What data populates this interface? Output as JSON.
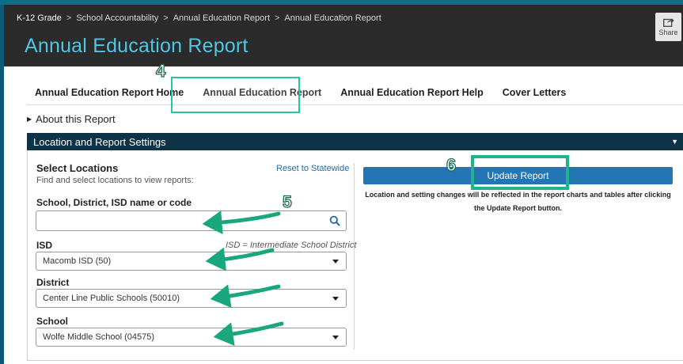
{
  "breadcrumb": [
    "K-12 Grade",
    "School Accountability",
    "Annual Education Report",
    "Annual Education Report"
  ],
  "breadcrumb_separator": ">",
  "page_title": "Annual Education Report",
  "share_label": "Share",
  "tabs": [
    {
      "label": "Annual Education Report Home",
      "active": false
    },
    {
      "label": "Annual Education Report",
      "active": true
    },
    {
      "label": "Annual Education Report Help",
      "active": false
    },
    {
      "label": "Cover Letters",
      "active": false
    }
  ],
  "about_label": "About this Report",
  "settings": {
    "title": "Location and Report Settings",
    "select_locations_title": "Select Locations",
    "select_locations_subtitle": "Find and select locations to view reports:",
    "reset_label": "Reset to Statewide",
    "search": {
      "label": "School, District, ISD name or code",
      "value": "",
      "placeholder": ""
    },
    "isd": {
      "label": "ISD",
      "note": "ISD = Intermediate School District",
      "value": "Macomb ISD (50)"
    },
    "district": {
      "label": "District",
      "value": "Center Line Public Schools (50010)"
    },
    "school": {
      "label": "School",
      "value": "Wolfe Middle School (04575)"
    },
    "update_button": "Update Report",
    "update_note": "Location and setting changes will be reflected in the report charts and tables after clicking the Update Report button."
  },
  "annotations": {
    "step_4": "4",
    "step_5": "5",
    "step_6": "6"
  },
  "colors": {
    "header_bg": "#2b2b2b",
    "title_color": "#4fc6e4",
    "settings_bar": "#0e3346",
    "update_button": "#2375b4",
    "annotation_green": "#27c59a"
  },
  "icons": {
    "share": "share-icon",
    "search": "search-icon",
    "chevron": "chevron-down-icon",
    "caret": "caret-right-icon"
  }
}
